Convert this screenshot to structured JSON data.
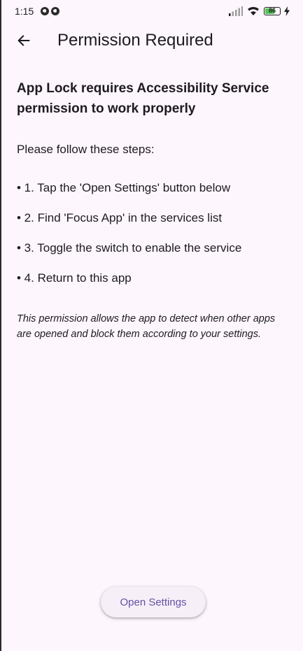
{
  "status_bar": {
    "time": "1:15",
    "battery_level": "86",
    "battery_fraction": 0.86
  },
  "app_bar": {
    "back_icon": "arrow-left-icon",
    "title": "Permission Required"
  },
  "content": {
    "headline": "App Lock requires Accessibility Service permission to work properly",
    "intro": "Please follow these steps:",
    "steps": [
      "• 1. Tap the 'Open Settings' button below",
      "• 2. Find 'Focus App' in the services list",
      "• 3. Toggle the switch to enable the service",
      "• 4. Return to this app"
    ],
    "note": "This permission allows the app to detect when other apps are opened and block them according to your settings."
  },
  "actions": {
    "open_settings_label": "Open Settings"
  },
  "colors": {
    "background": "#fdf6fc",
    "text": "#1d1b20",
    "primary": "#6750a4",
    "battery": "#53c653"
  }
}
